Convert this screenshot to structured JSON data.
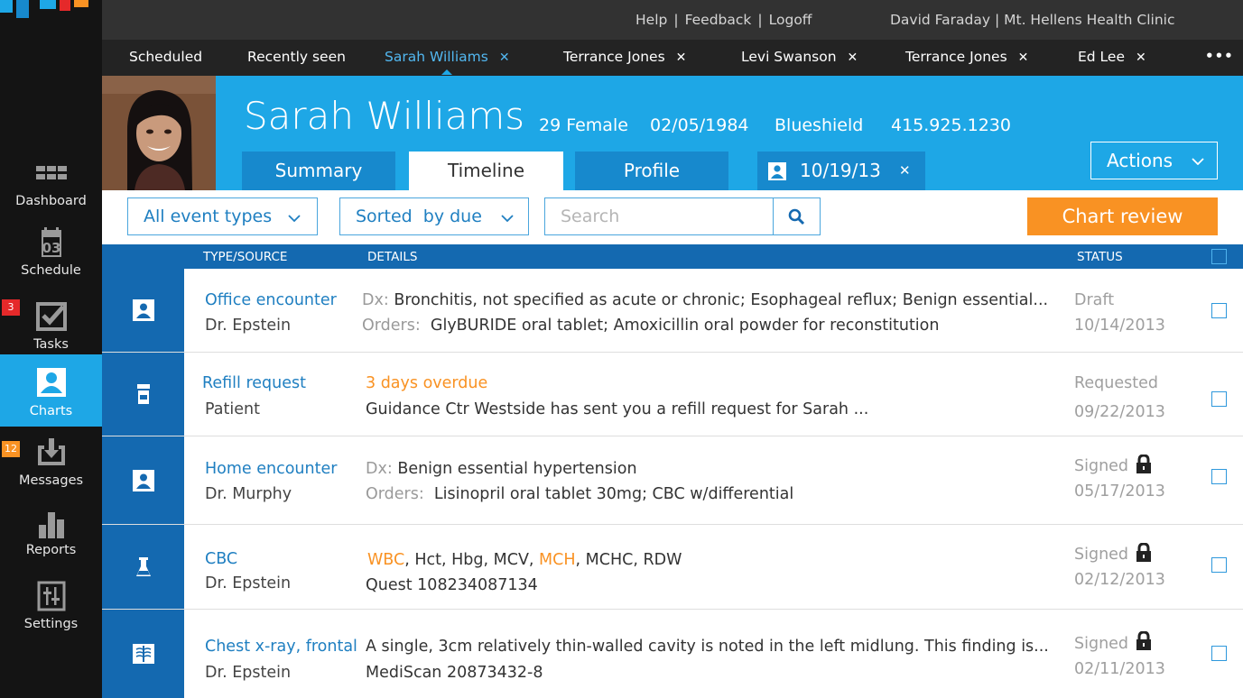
{
  "colors": {
    "brand_blue": "#1ea7e6",
    "dark_blue": "#1469b0",
    "accent_orange": "#f99223",
    "sidebar_bg": "#141414"
  },
  "sidebar": {
    "items": [
      {
        "label": "Dashboard",
        "icon": "grid-icon"
      },
      {
        "label": "Schedule",
        "icon": "calendar-icon",
        "icon_text": "03"
      },
      {
        "label": "Tasks",
        "icon": "checkbox-icon",
        "badge": "3",
        "badge_color": "#e5292a"
      },
      {
        "label": "Charts",
        "icon": "person-icon",
        "active": true
      },
      {
        "label": "Messages",
        "icon": "inbox-download-icon",
        "badge": "12",
        "badge_color": "#f99223"
      },
      {
        "label": "Reports",
        "icon": "bar-chart-icon"
      },
      {
        "label": "Settings",
        "icon": "sliders-icon"
      }
    ]
  },
  "topbar": {
    "help": "Help",
    "feedback": "Feedback",
    "logoff": "Logoff",
    "user": "David Faraday | Mt. Hellens Health Clinic"
  },
  "patient_tabs": [
    {
      "label": "Scheduled"
    },
    {
      "label": "Recently seen"
    },
    {
      "label": "Sarah Williams",
      "active": true,
      "closable": true
    },
    {
      "label": "Terrance Jones",
      "closable": true
    },
    {
      "label": "Levi Swanson",
      "closable": true
    },
    {
      "label": "Terrance Jones",
      "closable": true
    },
    {
      "label": "Ed Lee",
      "closable": true
    }
  ],
  "more_label": "•••",
  "patient": {
    "name": "Sarah Williams",
    "age_sex": "29 Female",
    "dob": "02/05/1984",
    "insurer": "Blueshield",
    "phone": "415.925.1230"
  },
  "header_tabs": [
    {
      "label": "Summary"
    },
    {
      "label": "Timeline",
      "active": true
    },
    {
      "label": "Profile"
    }
  ],
  "date_tab": {
    "label": "10/19/13"
  },
  "actions_label": "Actions",
  "filters": {
    "event_types": "All event types",
    "sort": "Sorted  by due",
    "search_placeholder": "Search",
    "chart_review": "Chart review"
  },
  "table": {
    "headers": {
      "type": "TYPE/SOURCE",
      "details": "DETAILS",
      "status": "STATUS"
    },
    "rows": [
      {
        "icon": "person-icon",
        "type": "Office encounter",
        "source": "Dr. Epstein",
        "d1_prefix": "Dx:",
        "d1": "Bronchitis, not specified as acute or chronic; Esophageal reflux; Benign essential...",
        "d2_prefix": "Orders:",
        "d2": "GlyBURIDE oral tablet; Amoxicillin oral powder for reconstitution",
        "status": "Draft",
        "date": "10/14/2013",
        "locked": false
      },
      {
        "icon": "pill-bottle-icon",
        "type": "Refill request",
        "source": "Patient",
        "d1": "3 days overdue",
        "d2": "Guidance Ctr Westside has sent you a refill request for Sarah ...",
        "status": "Requested",
        "date": "09/22/2013",
        "locked": false
      },
      {
        "icon": "person-icon",
        "type": "Home encounter",
        "source": "Dr. Murphy",
        "d1_prefix": "Dx:",
        "d1": "Benign essential hypertension",
        "d2_prefix": "Orders:",
        "d2": "Lisinopril oral tablet 30mg; CBC w/differential",
        "status": "Signed",
        "date": "05/17/2013",
        "locked": true
      },
      {
        "icon": "flask-icon",
        "type": "CBC",
        "source": "Dr. Epstein",
        "d1_parts": [
          {
            "text": "WBC",
            "hl": true
          },
          {
            "text": ", Hct, Hbg, MCV, "
          },
          {
            "text": "MCH",
            "hl": true
          },
          {
            "text": ", MCHC, RDW"
          }
        ],
        "d2": "Quest 108234087134",
        "status": "Signed",
        "date": "02/12/2013",
        "locked": true
      },
      {
        "icon": "xray-icon",
        "type": "Chest x-ray, frontal",
        "source": "Dr. Epstein",
        "d1": "A single, 3cm relatively thin-walled cavity is noted in the left midlung. This finding is...",
        "d2": "MediScan 20873432-8",
        "status": "Signed",
        "date": "02/11/2013",
        "locked": true
      }
    ]
  }
}
